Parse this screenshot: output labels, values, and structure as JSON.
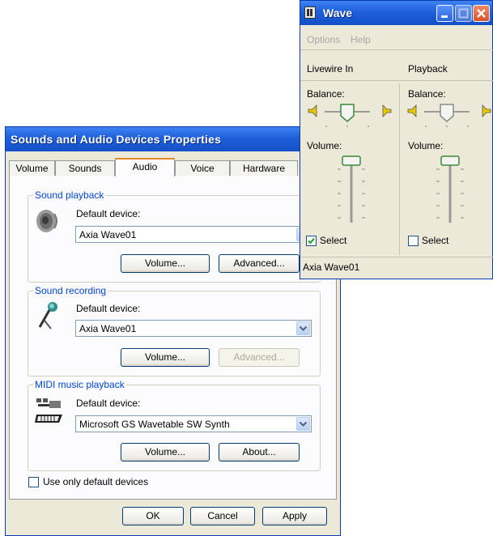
{
  "dialog": {
    "title": "Sounds and Audio Devices Properties",
    "tabs": [
      "Volume",
      "Sounds",
      "Audio",
      "Voice",
      "Hardware"
    ],
    "active_tab": "Audio",
    "sound_playback": {
      "legend": "Sound playback",
      "device_label": "Default device:",
      "device_value": "Axia Wave01",
      "volume_button": "Volume...",
      "advanced_button": "Advanced..."
    },
    "sound_recording": {
      "legend": "Sound recording",
      "device_label": "Default device:",
      "device_value": "Axia Wave01",
      "volume_button": "Volume...",
      "advanced_button": "Advanced..."
    },
    "midi_playback": {
      "legend": "MIDI music playback",
      "device_label": "Default device:",
      "device_value": "Microsoft GS Wavetable SW Synth",
      "volume_button": "Volume...",
      "about_button": "About..."
    },
    "use_only_default": {
      "label": "Use only default devices",
      "checked": false
    },
    "ok_button": "OK",
    "cancel_button": "Cancel",
    "apply_button": "Apply"
  },
  "wave": {
    "title": "Wave",
    "menu": [
      "Options",
      "Help"
    ],
    "columns": [
      {
        "name": "Livewire In",
        "balance_label": "Balance:",
        "volume_label": "Volume:",
        "select_label": "Select",
        "selected": true
      },
      {
        "name": "Playback",
        "balance_label": "Balance:",
        "volume_label": "Volume:",
        "select_label": "Select",
        "selected": false
      }
    ],
    "status": "Axia Wave01"
  },
  "colors": {
    "titlebar": "#1f5fd8",
    "dialog_bg": "#ece9d8",
    "group_legend": "#0046d5",
    "close_button": "#d9542f"
  }
}
